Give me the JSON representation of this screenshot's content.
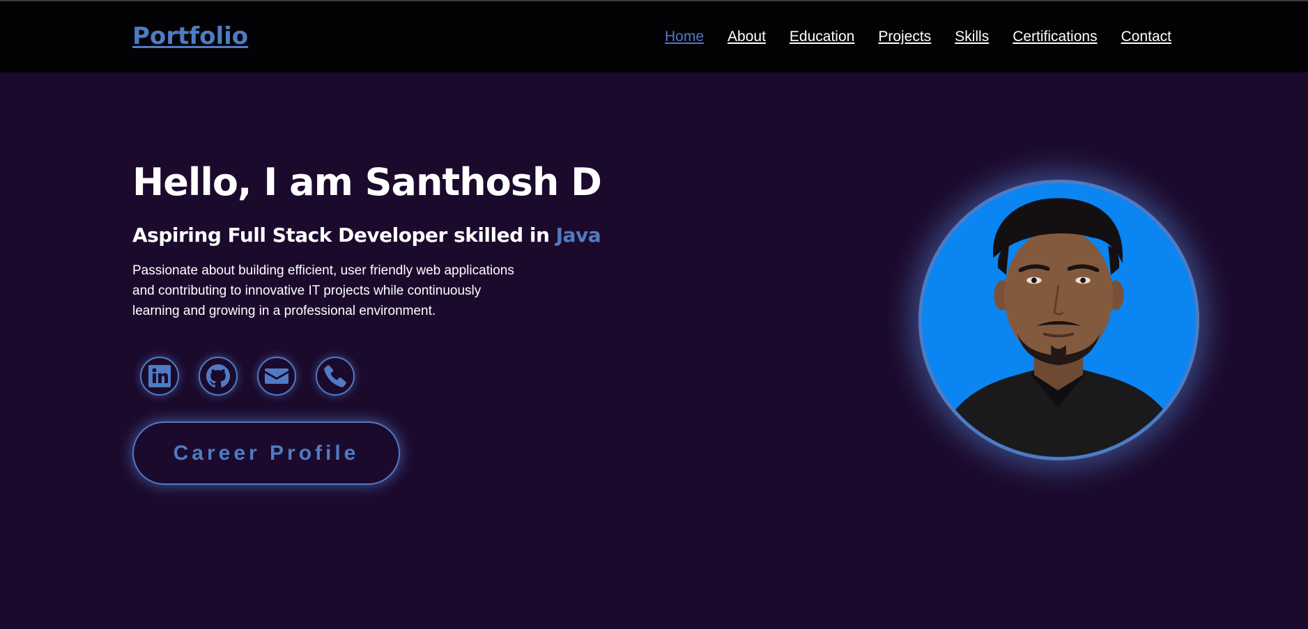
{
  "header": {
    "logo": "Portfolio",
    "nav": [
      "Home",
      "About",
      "Education",
      "Projects",
      "Skills",
      "Certifications",
      "Contact"
    ],
    "active": "Home"
  },
  "hero": {
    "greeting": "Hello, I am Santhosh D",
    "subtitle_prefix": "Aspiring Full Stack Developer skilled in",
    "subtitle_highlight": "Java",
    "description": "Passionate about building efficient, user friendly web applications and contributing to innovative IT projects while continuously learning and growing in a professional environment.",
    "social_icons": [
      "linkedin-icon",
      "github-icon",
      "mail-icon",
      "phone-icon"
    ],
    "cta_label": "Career Profile"
  },
  "colors": {
    "background": "#1c0a2d",
    "header": "#030204",
    "accent": "#4f7bc4",
    "photo_background": "#0a85f2"
  }
}
